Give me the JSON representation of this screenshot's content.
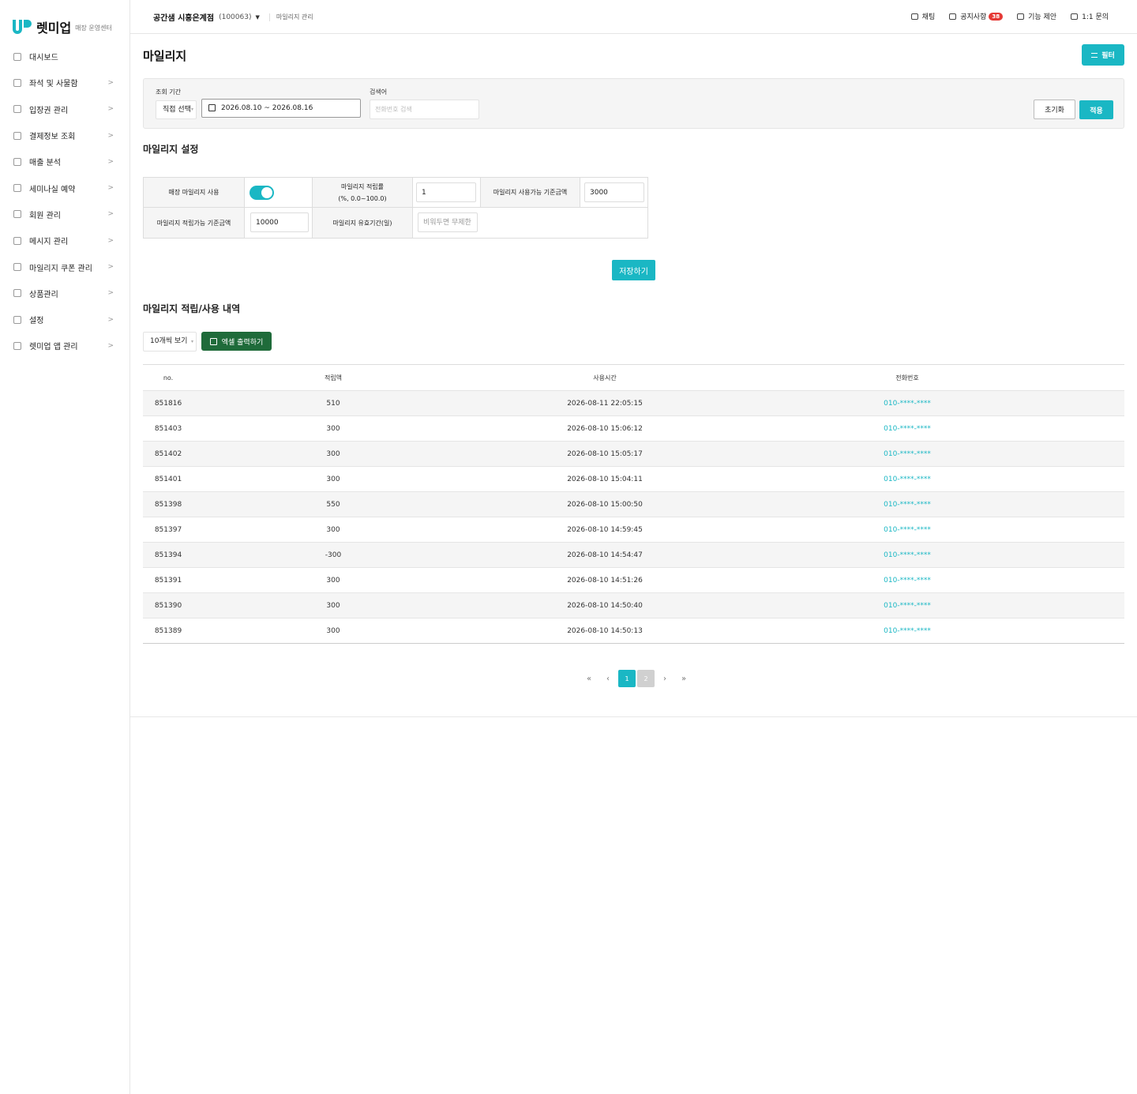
{
  "brand": {
    "name": "렛미업",
    "subtitle": "매장 운영센터"
  },
  "sidebar": {
    "items": [
      {
        "label": "대시보드",
        "icon": "grid-icon",
        "chevron": ""
      },
      {
        "label": "좌석 및 사물함",
        "icon": "seat-icon",
        "chevron": ">"
      },
      {
        "label": "입장권 관리",
        "icon": "ticket-icon",
        "chevron": ">"
      },
      {
        "label": "결제정보 조회",
        "icon": "card-icon",
        "chevron": ">"
      },
      {
        "label": "매출 분석",
        "icon": "chart-icon",
        "chevron": ">"
      },
      {
        "label": "세미나실 예약",
        "icon": "calendar-icon",
        "chevron": ">"
      },
      {
        "label": "회원 관리",
        "icon": "users-icon",
        "chevron": ">"
      },
      {
        "label": "메시지 관리",
        "icon": "mail-icon",
        "chevron": ">"
      },
      {
        "label": "마일리지 쿠폰 관리",
        "icon": "coupon-icon",
        "chevron": ">"
      },
      {
        "label": "상품관리",
        "icon": "product-icon",
        "chevron": ">"
      },
      {
        "label": "설정",
        "icon": "gear-icon",
        "chevron": ">"
      },
      {
        "label": "렛미업 앱 관리",
        "icon": "app-icon",
        "chevron": ">"
      }
    ]
  },
  "topbar": {
    "store_name": "공간샘 시흥은계점",
    "store_code": "(100063)",
    "caret": "▼",
    "breadcrumb": "마일리지 관리",
    "tools": {
      "chat": "채팅",
      "notice": "공지사항",
      "notice_badge": "38",
      "suggest": "기능 제안",
      "inquiry": "1:1 문의"
    }
  },
  "page": {
    "title": "마일리지",
    "filter_button": "필터"
  },
  "filter": {
    "period_label": "조회 기간",
    "period_select": "직접 선택",
    "date_range": "2026.08.10 ~ 2026.08.16",
    "search_label": "검색어",
    "search_placeholder": "전화번호 검색",
    "reset": "초기화",
    "apply": "적용"
  },
  "settings": {
    "title": "마일리지 설정",
    "use_label": "매장 마일리지 사용",
    "use_enabled": true,
    "rate_label": "마일리지 적립률",
    "rate_sub": "(%, 0.0~100.0)",
    "rate_value": "1",
    "min_use_label": "마일리지 사용가능 기준금액",
    "min_use_value": "3000",
    "min_earn_label": "마일리지 적립가능 기준금액",
    "min_earn_value": "10000",
    "expiry_label": "마일리지 유효기간(일)",
    "expiry_placeholder": "비워두면 무제한",
    "save": "저장하기"
  },
  "history": {
    "title": "마일리지 적립/사용 내역",
    "per_page": "10개씩 보기",
    "excel": "엑셀 출력하기",
    "columns": [
      "no.",
      "적립액",
      "사용시간",
      "전화번호"
    ],
    "rows": [
      {
        "no": "851816",
        "amount": "510",
        "time": "2026-08-11 22:05:15",
        "phone": "010-****-****"
      },
      {
        "no": "851403",
        "amount": "300",
        "time": "2026-08-10 15:06:12",
        "phone": "010-****-****"
      },
      {
        "no": "851402",
        "amount": "300",
        "time": "2026-08-10 15:05:17",
        "phone": "010-****-****"
      },
      {
        "no": "851401",
        "amount": "300",
        "time": "2026-08-10 15:04:11",
        "phone": "010-****-****"
      },
      {
        "no": "851398",
        "amount": "550",
        "time": "2026-08-10 15:00:50",
        "phone": "010-****-****"
      },
      {
        "no": "851397",
        "amount": "300",
        "time": "2026-08-10 14:59:45",
        "phone": "010-****-****"
      },
      {
        "no": "851394",
        "amount": "-300",
        "time": "2026-08-10 14:54:47",
        "phone": "010-****-****"
      },
      {
        "no": "851391",
        "amount": "300",
        "time": "2026-08-10 14:51:26",
        "phone": "010-****-****"
      },
      {
        "no": "851390",
        "amount": "300",
        "time": "2026-08-10 14:50:40",
        "phone": "010-****-****"
      },
      {
        "no": "851389",
        "amount": "300",
        "time": "2026-08-10 14:50:13",
        "phone": "010-****-****"
      }
    ]
  },
  "pagination": {
    "first": "«",
    "prev": "‹",
    "pages": [
      "1",
      "2"
    ],
    "current": "1",
    "next": "›",
    "last": "»"
  },
  "colors": {
    "accent": "#1ab7c4",
    "excel": "#1f6b3a",
    "badge": "#e53935"
  }
}
